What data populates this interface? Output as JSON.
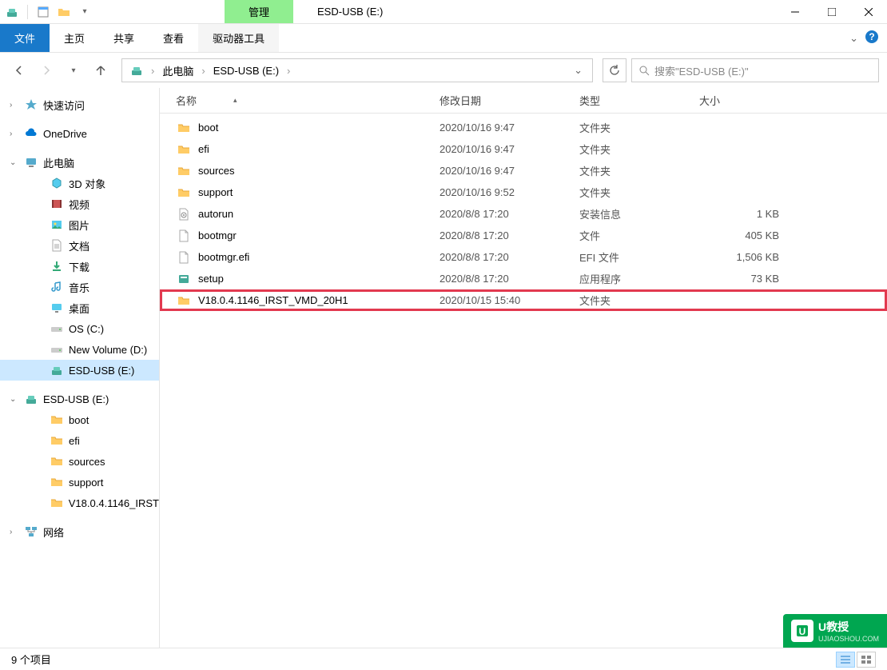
{
  "window": {
    "title": "ESD-USB (E:)",
    "manage_tab": "管理"
  },
  "ribbon": {
    "file": "文件",
    "home": "主页",
    "share": "共享",
    "view": "查看",
    "drive_tools": "驱动器工具"
  },
  "breadcrumb": {
    "items": [
      "此电脑",
      "ESD-USB (E:)"
    ]
  },
  "search": {
    "placeholder": "搜索\"ESD-USB (E:)\""
  },
  "sidebar": {
    "quick_access": "快速访问",
    "onedrive": "OneDrive",
    "this_pc": "此电脑",
    "pc_items": [
      "3D 对象",
      "视频",
      "图片",
      "文档",
      "下载",
      "音乐",
      "桌面",
      "OS (C:)",
      "New Volume (D:)",
      "ESD-USB (E:)"
    ],
    "usb_root": "ESD-USB (E:)",
    "usb_items": [
      "boot",
      "efi",
      "sources",
      "support",
      "V18.0.4.1146_IRST"
    ],
    "network": "网络"
  },
  "columns": {
    "name": "名称",
    "date": "修改日期",
    "type": "类型",
    "size": "大小"
  },
  "files": [
    {
      "icon": "folder",
      "name": "boot",
      "date": "2020/10/16 9:47",
      "type": "文件夹",
      "size": ""
    },
    {
      "icon": "folder",
      "name": "efi",
      "date": "2020/10/16 9:47",
      "type": "文件夹",
      "size": ""
    },
    {
      "icon": "folder",
      "name": "sources",
      "date": "2020/10/16 9:47",
      "type": "文件夹",
      "size": ""
    },
    {
      "icon": "folder",
      "name": "support",
      "date": "2020/10/16 9:52",
      "type": "文件夹",
      "size": ""
    },
    {
      "icon": "inf",
      "name": "autorun",
      "date": "2020/8/8 17:20",
      "type": "安装信息",
      "size": "1 KB"
    },
    {
      "icon": "file",
      "name": "bootmgr",
      "date": "2020/8/8 17:20",
      "type": "文件",
      "size": "405 KB"
    },
    {
      "icon": "file",
      "name": "bootmgr.efi",
      "date": "2020/8/8 17:20",
      "type": "EFI 文件",
      "size": "1,506 KB"
    },
    {
      "icon": "exe",
      "name": "setup",
      "date": "2020/8/8 17:20",
      "type": "应用程序",
      "size": "73 KB"
    },
    {
      "icon": "folder",
      "name": "V18.0.4.1146_IRST_VMD_20H1",
      "date": "2020/10/15 15:40",
      "type": "文件夹",
      "size": "",
      "highlight": true
    }
  ],
  "status": {
    "count": "9 个项目"
  },
  "watermark": {
    "title": "U教授",
    "sub": "UJIAOSHOU.COM"
  },
  "colors": {
    "accent": "#1979ca",
    "highlight": "#e2394f",
    "manage": "#90ee90"
  }
}
